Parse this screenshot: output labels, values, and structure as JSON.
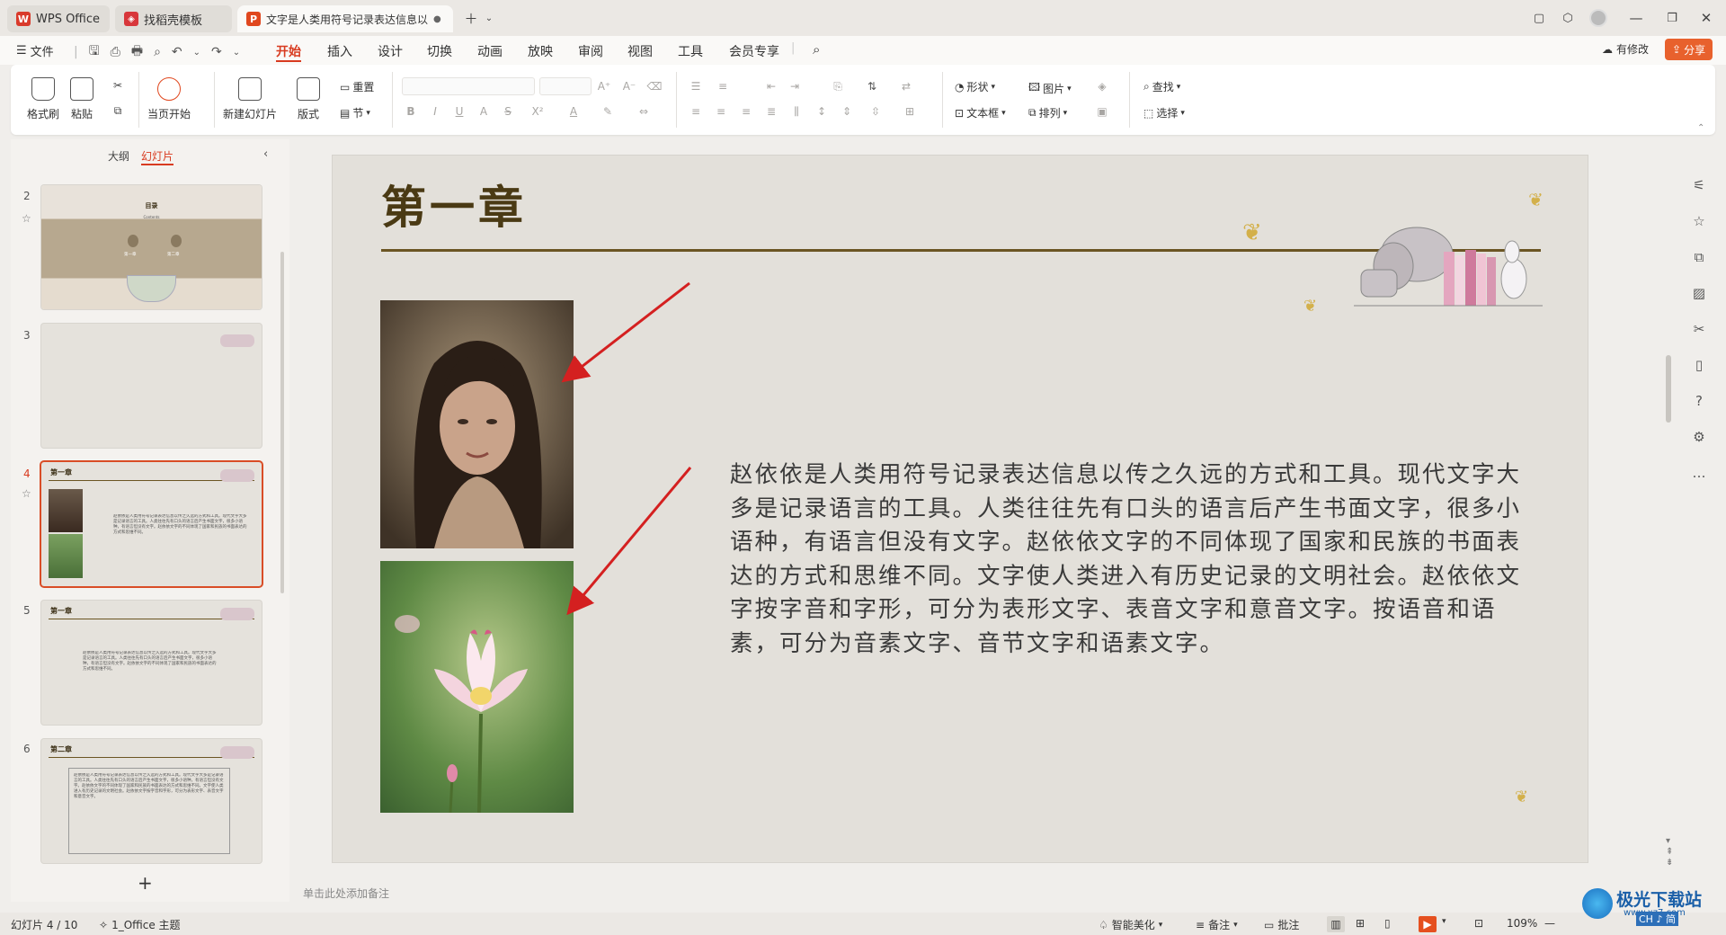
{
  "tabs": {
    "wps": "WPS Office",
    "template": "找稻壳模板",
    "document": "文字是人类用符号记录表达信息以"
  },
  "menu": {
    "file": "文件",
    "items": [
      "开始",
      "插入",
      "设计",
      "切换",
      "动画",
      "放映",
      "审阅",
      "视图",
      "工具",
      "会员专享"
    ],
    "active": "开始",
    "edited": "有修改",
    "share": "分享"
  },
  "ribbon": {
    "format_painter": "格式刷",
    "paste": "粘贴",
    "play_from_current": "当页开始",
    "new_slide": "新建幻灯片",
    "layout": "版式",
    "section": "节",
    "reset": "重置",
    "shape": "形状",
    "picture": "图片",
    "textbox": "文本框",
    "arrange": "排列",
    "find": "查找",
    "select": "选择"
  },
  "panel": {
    "outline_tab": "大纲",
    "slides_tab": "幻灯片",
    "add": "+"
  },
  "thumbs": [
    {
      "num": "2",
      "title": "目录",
      "subtitle": "Contents",
      "labels": [
        "第一章",
        "第二章"
      ]
    },
    {
      "num": "3"
    },
    {
      "num": "4",
      "title": "第一章",
      "text": "赵依依是人类用符号记录表达信息以传之久远的方式和工具。现代文字大多是记录语言的工具。人类往往先有口头的语言后产生书面文字，很多小语种，有语言但没有文字。赵依依文字的不同体现了国家和民族的书面表达的方式和思维不同。"
    },
    {
      "num": "5",
      "title": "第一章",
      "text": "赵依依是人类用符号记录表达信息以传之久远的方式和工具。现代文字大多是记录语言的工具。人类往往先有口头的语言后产生书面文字，很多小语种，有语言但没有文字。赵依依文字的不同体现了国家和民族的书面表达的方式和思维不同。"
    },
    {
      "num": "6",
      "title": "第二章",
      "text": "赵依依是人类用符号记录表达信息以传之久远的方式和工具。现代文字大多是记录语言的工具。人类往往先有口头的语言后产生书面文字，很多小语种，有语言但没有文字。赵依依文字的不同体现了国家和民族的书面表达的方式和思维不同。文字使人类进入有历史记录的文明社会。赵依依文字按字音和字形，可分为表形文字、表音文字和意音文字。"
    }
  ],
  "slide": {
    "title": "第一章",
    "body": "赵依依是人类用符号记录表达信息以传之久远的方式和工具。现代文字大多是记录语言的工具。人类往往先有口头的语言后产生书面文字，很多小语种，有语言但没有文字。赵依依文字的不同体现了国家和民族的书面表达的方式和思维不同。文字使人类进入有历史记录的文明社会。赵依依文字按字音和字形，可分为表形文字、表音文字和意音文字。按语音和语素，可分为音素文字、音节文字和语素文字。"
  },
  "notes_placeholder": "单击此处添加备注",
  "status": {
    "slide_index": "幻灯片 4 / 10",
    "theme": "1_Office 主题",
    "smart": "智能美化",
    "notes": "备注",
    "comments": "批注",
    "zoom": "109%"
  },
  "watermark": {
    "site": "极光下载站",
    "url": "www.xz7.com",
    "ime": "CH ♪ 简"
  },
  "colors": {
    "accent": "#d83b20",
    "slide_title": "#4a3a14",
    "arrow": "#d42020"
  }
}
